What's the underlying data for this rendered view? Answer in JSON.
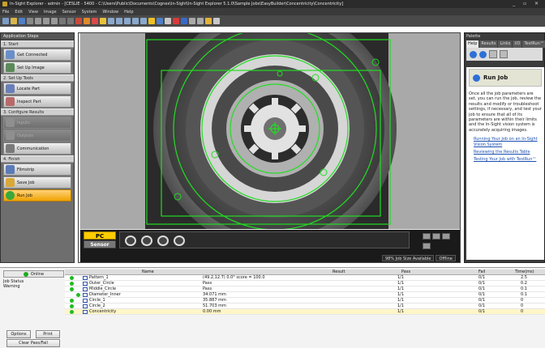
{
  "window": {
    "title": "In-Sight Explorer - admin - [CESLIE - 5400 - C:\\Users\\Public\\Documents\\Cognex\\In-Sight\\In-Sight Explorer 5.1.0\\Sample Jobs\\EasyBuilder\\Concentricity\\Concentricity]"
  },
  "menu": [
    "File",
    "Edit",
    "View",
    "Image",
    "Sensor",
    "System",
    "Window",
    "Help"
  ],
  "application_steps": {
    "title": "Application Steps",
    "sections": [
      {
        "head": "1. Start",
        "items": [
          {
            "label": "Get Connected",
            "state": "normal"
          },
          {
            "label": "Set Up Image",
            "state": "normal"
          }
        ]
      },
      {
        "head": "2. Set Up Tools",
        "items": [
          {
            "label": "Locate Part",
            "state": "normal"
          },
          {
            "label": "Inspect Part",
            "state": "normal"
          }
        ]
      },
      {
        "head": "3. Configure Results",
        "items": [
          {
            "label": "Inputs",
            "state": "disabled"
          },
          {
            "label": "Outputs",
            "state": "disabled"
          },
          {
            "label": "Communication",
            "state": "normal"
          }
        ]
      },
      {
        "head": "4. Finish",
        "items": [
          {
            "label": "Filmstrip",
            "state": "normal"
          },
          {
            "label": "Save Job",
            "state": "normal"
          },
          {
            "label": "Run Job",
            "state": "active"
          }
        ]
      }
    ]
  },
  "viewer": {
    "pc_label": "PC",
    "sensor_label": "Sensor",
    "status": [
      "98% Job Size Available",
      "Offline"
    ],
    "accent": "#22dd22"
  },
  "palette": {
    "title": "Palette",
    "tabs": [
      "Help",
      "Results",
      "Links",
      "I/O",
      "TestRun™"
    ],
    "help_title": "Run Job",
    "help_text": "Once all the job parameters are set, you can run the job, review the results and modify or troubleshoot settings, if necessary, and test your job to ensure that all of its parameters are within their limits and the In-Sight vision system is accurately acquiring images.",
    "links": [
      "Running Your Job on an In-Sight Vision System",
      "Reviewing the Results Table",
      "Testing Your Job with TestRun™"
    ]
  },
  "bottom": {
    "online_label": "Online",
    "job_status_label": "Job Status",
    "job_status_value": "Warning",
    "options_label": "Options",
    "print_label": "Print",
    "clear_label": "Clear Pass/Fail"
  },
  "results": {
    "headers": {
      "name": "Name",
      "result": "Result",
      "pass": "Pass",
      "fail": "Fail",
      "time": "Time(ms)"
    },
    "rows": [
      {
        "name": "Pattern_1",
        "result": "(49.2,12.7) 0.0° score = 100.0",
        "pass": "1/1",
        "fail": "0/1",
        "time": "2.5"
      },
      {
        "name": "Outer_Circle",
        "result": "Pass",
        "pass": "1/1",
        "fail": "0/1",
        "time": "0.2"
      },
      {
        "name": "Middle_Circle",
        "result": "Pass",
        "pass": "1/1",
        "fail": "0/1",
        "time": "0.1"
      },
      {
        "name": "Diameter_Inner",
        "result": "34.071 mm",
        "pass": "1/1",
        "fail": "0/1",
        "time": "0.1"
      },
      {
        "name": "Circle_1",
        "result": "35.887 mm",
        "pass": "1/1",
        "fail": "0/1",
        "time": "0"
      },
      {
        "name": "Circle_2",
        "result": "51.703 mm",
        "pass": "1/1",
        "fail": "0/1",
        "time": "0"
      },
      {
        "name": "Concentricity",
        "result": "0.00 mm",
        "pass": "1/1",
        "fail": "0/1",
        "time": "0"
      }
    ]
  }
}
